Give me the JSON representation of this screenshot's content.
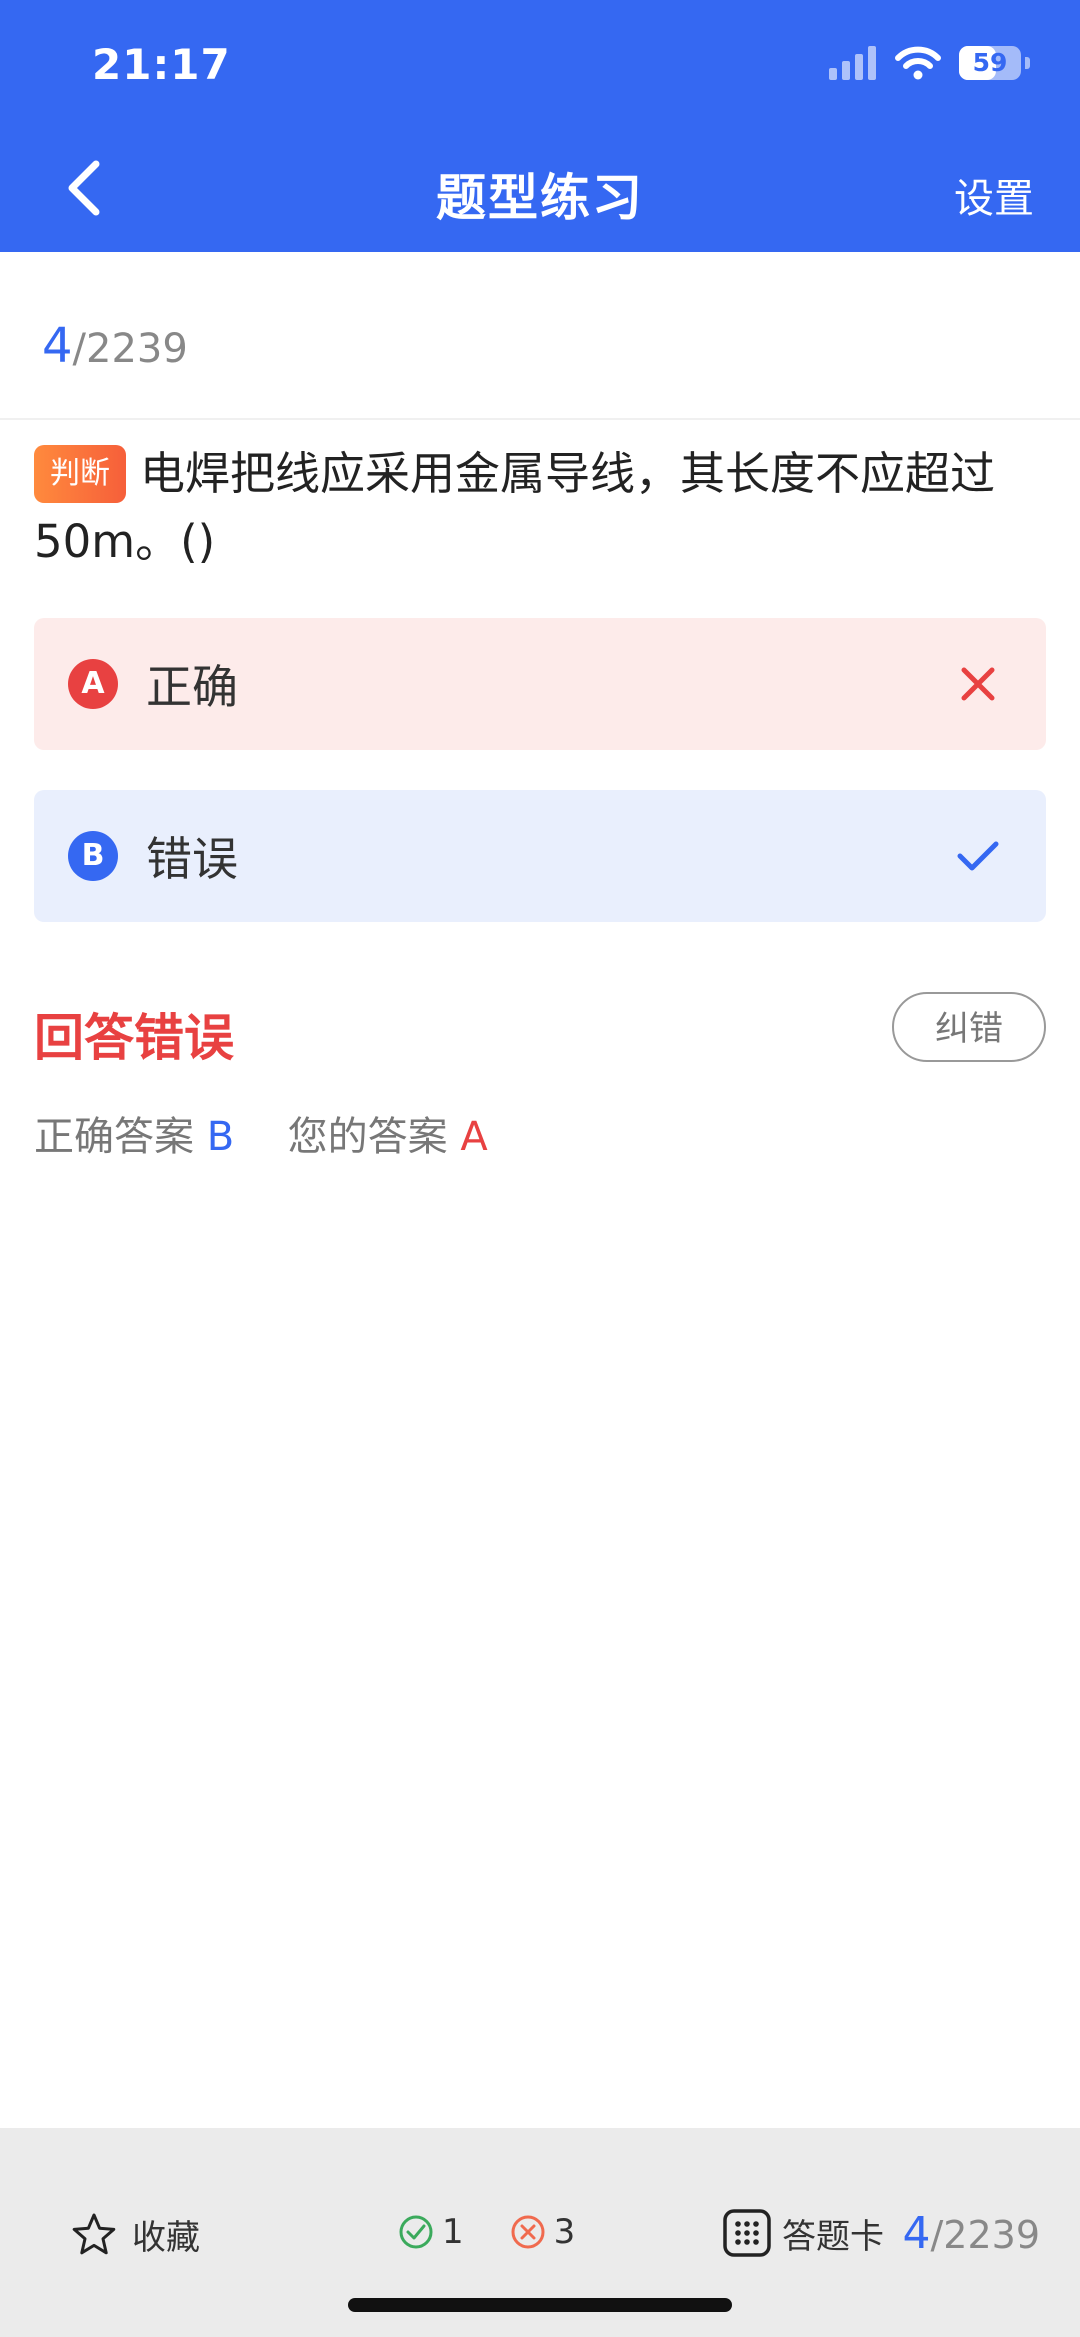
{
  "status": {
    "time": "21:17",
    "battery": "59"
  },
  "nav": {
    "title": "题型练习",
    "settings": "设置"
  },
  "progress": {
    "current": "4",
    "total": "/2239"
  },
  "question": {
    "tag": "判断",
    "text": "电焊把线应采用金属导线，其长度不应超过50m。()"
  },
  "options": [
    {
      "letter": "A",
      "text": "正确",
      "state": "wrong"
    },
    {
      "letter": "B",
      "text": "错误",
      "state": "correct"
    }
  ],
  "result": {
    "title": "回答错误",
    "report_label": "纠错",
    "correct_label": "正确答案",
    "correct_value": "B",
    "yours_label": "您的答案",
    "yours_value": "A"
  },
  "footer": {
    "favorite": "收藏",
    "right_count": "1",
    "wrong_count": "3",
    "answer_card": "答题卡",
    "current": "4",
    "total": "/2239"
  },
  "colors": {
    "primary": "#3568F2",
    "error": "#E84141",
    "tag": "#F65F3A"
  }
}
